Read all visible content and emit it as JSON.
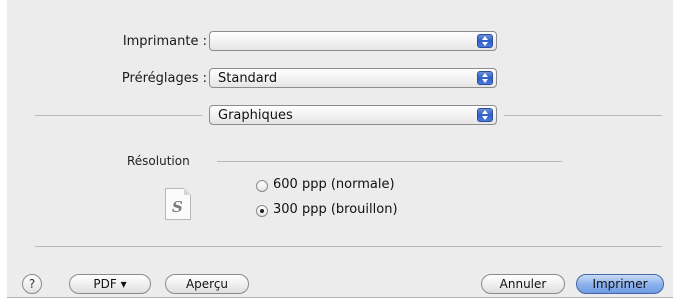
{
  "printer": {
    "label": "Imprimante :",
    "value": ""
  },
  "presets": {
    "label": "Préréglages :",
    "value": "Standard"
  },
  "panel": {
    "value": "Graphiques"
  },
  "resolution": {
    "title": "Résolution",
    "options": [
      {
        "label": "600 ppp (normale)",
        "selected": false
      },
      {
        "label": "300 ppp (brouillon)",
        "selected": true
      }
    ]
  },
  "footer": {
    "help": "?",
    "pdf": "PDF ▾",
    "preview": "Aperçu",
    "cancel": "Annuler",
    "print": "Imprimer"
  },
  "icons": {
    "doc_glyph": "S",
    "popup_arrow": "updown-arrows-icon"
  },
  "colors": {
    "dialog_bg": "#ececec",
    "accent_blue": "#2f5fc9",
    "default_button": "#8eb3ec"
  }
}
